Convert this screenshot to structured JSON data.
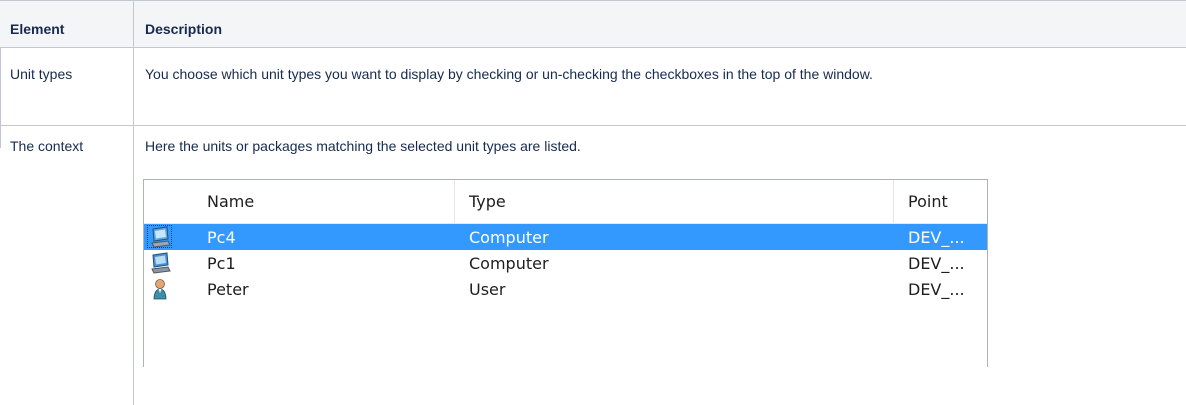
{
  "table": {
    "headers": {
      "element": "Element",
      "description": "Description"
    },
    "rows": [
      {
        "element": "Unit types",
        "description": "You choose which unit types you want to display by checking or un-checking the checkboxes in the top of the window."
      },
      {
        "element": "The context",
        "description": "Here the units or packages matching the selected unit types are listed."
      }
    ]
  },
  "listview": {
    "columns": [
      "Name",
      "Type",
      "Point"
    ],
    "rows": [
      {
        "icon": "computer-icon",
        "name": "Pc4",
        "type": "Computer",
        "point": "DEV_...",
        "selected": true
      },
      {
        "icon": "computer-icon",
        "name": "Pc1",
        "type": "Computer",
        "point": "DEV_...",
        "selected": false
      },
      {
        "icon": "user-icon",
        "name": "Peter",
        "type": "User",
        "point": "DEV_...",
        "selected": false
      }
    ],
    "selection_color": "#3399ff"
  }
}
